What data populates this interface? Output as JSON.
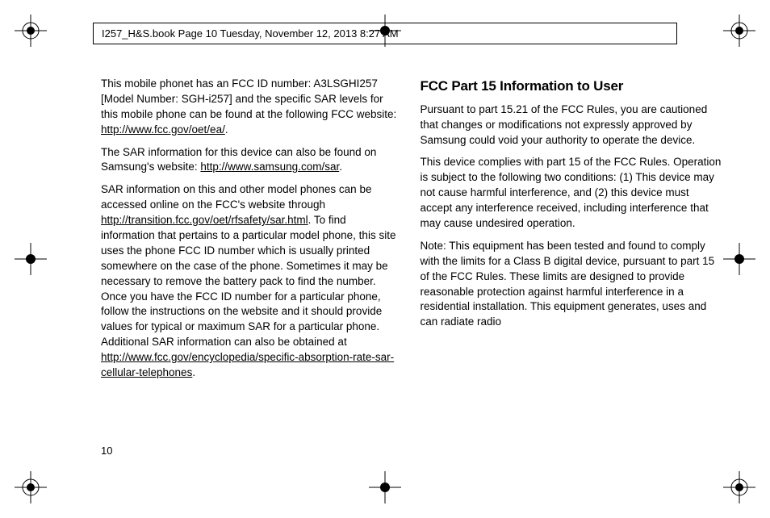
{
  "header": "I257_H&S.book  Page 10  Tuesday, November 12, 2013  8:27 AM",
  "pageNumber": "10",
  "col1": {
    "p1_a": "This mobile phonet has an FCC ID number: A3LSGHI257 [Model Number: SGH-i257] and the specific SAR levels for this mobile phone can be found at the following FCC website: ",
    "p1_link": "http://www.fcc.gov/oet/ea/",
    "p1_b": ".",
    "p2_a": "The SAR information for this device can also be found on Samsung's website: ",
    "p2_link": "http://www.samsung.com/sar",
    "p2_b": ".",
    "p3_a": "SAR information on this and other model phones can be accessed online on the FCC's website through ",
    "p3_link1": "http://transition.fcc.gov/oet/rfsafety/sar.html",
    "p3_b": ". To find information that pertains to a particular model phone, this site uses the phone FCC ID number which is usually printed somewhere on the case of the phone. Sometimes it may be necessary to remove the battery pack to find the number. Once you have the FCC ID number for a particular phone, follow the instructions on the website and it should provide values for typical or maximum SAR for a particular phone. Additional SAR information can also be obtained at",
    "p3_link2": "http://www.fcc.gov/encyclopedia/specific-absorption-rate-sar-cellular-telephones",
    "p3_c": "."
  },
  "col2": {
    "heading": "FCC Part 15 Information to User",
    "p1": "Pursuant to part 15.21 of the FCC Rules, you are cautioned that changes or modifications not expressly approved by Samsung could void your authority to operate the device.",
    "p2": "This device complies with part 15 of the FCC Rules. Operation is subject to the following two conditions: (1) This device may not cause harmful interference, and (2) this device must accept any interference received, including interference that may cause undesired operation.",
    "p3": "Note: This equipment has been tested and found to comply with the limits for a Class B digital device, pursuant to part 15 of the FCC Rules. These limits are designed to provide reasonable protection against harmful interference in a residential installation. This equipment generates, uses and can radiate radio"
  }
}
